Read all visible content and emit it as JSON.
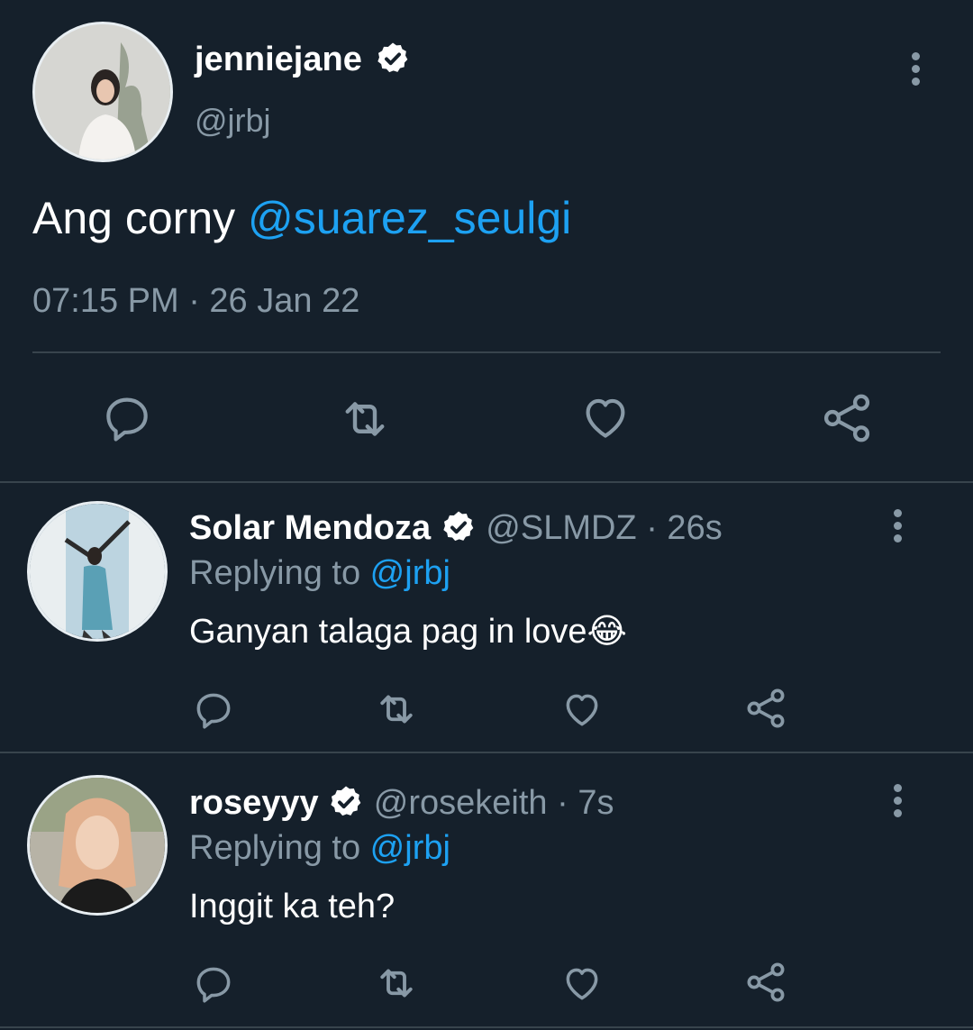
{
  "main_tweet": {
    "display_name": "jenniejane",
    "handle": "@jrbj",
    "text_prefix": "Ang corny ",
    "mention": "@suarez_seulgi",
    "timestamp": "07:15 PM · 26 Jan 22",
    "verified_icon": "verified-badge-icon"
  },
  "replies": [
    {
      "display_name": "Solar Mendoza",
      "handle": "@SLMDZ",
      "time": "· 26s",
      "replying_label": "Replying to ",
      "replying_to": "@jrbj",
      "text": "Ganyan talaga pag in love😂"
    },
    {
      "display_name": "roseyyy",
      "handle": "@rosekeith",
      "time": "· 7s",
      "replying_label": "Replying to ",
      "replying_to": "@jrbj",
      "text": "Inggit ka teh?"
    }
  ],
  "icons": [
    "comment-icon",
    "retweet-icon",
    "like-icon",
    "share-icon",
    "more-icon"
  ],
  "colors": {
    "background": "#15202b",
    "muted": "#8899a6",
    "link": "#1da1f2",
    "divider": "#38444d"
  }
}
